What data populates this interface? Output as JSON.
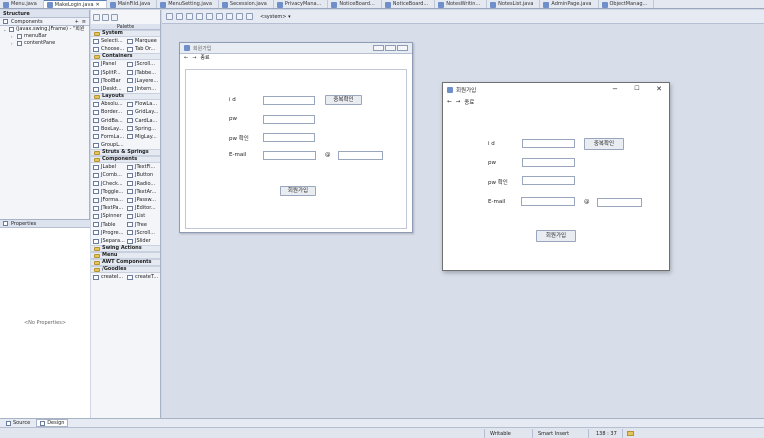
{
  "editor_tabs": [
    {
      "label": "Menu.java",
      "active": false
    },
    {
      "label": "MakeLogin.java",
      "active": true
    },
    {
      "label": "MainFild.java",
      "active": false
    },
    {
      "label": "MenuSetting.java",
      "active": false
    },
    {
      "label": "Secession.java",
      "active": false
    },
    {
      "label": "PrivacyMana...",
      "active": false
    },
    {
      "label": "NoticeBoard...",
      "active": false
    },
    {
      "label": "NoticeBoard...",
      "active": false
    },
    {
      "label": "NotesWritin...",
      "active": false
    },
    {
      "label": "NotesList.java",
      "active": false
    },
    {
      "label": "AdminPage.java",
      "active": false
    },
    {
      "label": "ObjectManag...",
      "active": false
    }
  ],
  "structure": {
    "title": "Structure",
    "components_label": "Components",
    "tree": [
      {
        "label": "(javax.swing.JFrame) - \"회원",
        "level": 0
      },
      {
        "label": "menuBar",
        "level": 1
      },
      {
        "label": "contentPane",
        "level": 1
      }
    ]
  },
  "properties": {
    "title": "Properties",
    "empty": "<No Properties>"
  },
  "palette": {
    "title": "Palette",
    "sections": [
      {
        "name": "System",
        "items": [
          "Selecti...",
          "Marquee",
          "Choose...",
          "Tab Or..."
        ]
      },
      {
        "name": "Containers",
        "items": [
          "JPanel",
          "JScroll...",
          "JSplitP...",
          "JTabbe...",
          "JToolBar",
          "JLayere...",
          "JDeskt...",
          "JIntern..."
        ]
      },
      {
        "name": "Layouts",
        "items": [
          "Absolu...",
          "FlowLa...",
          "Border...",
          "GridLay...",
          "GridBa...",
          "CardLa...",
          "BoxLay...",
          "Spring...",
          "FormLa...",
          "MigLay...",
          "GroupL..."
        ]
      },
      {
        "name": "Struts & Springs",
        "items": []
      },
      {
        "name": "Components",
        "items": [
          "JLabel",
          "JTextFi...",
          "JComb...",
          "JButton",
          "JCheck...",
          "JRadio...",
          "JToggle...",
          "JTextAr...",
          "JForma...",
          "JPassw...",
          "JTextPa...",
          "JEditor...",
          "JSpinner",
          "JList",
          "JTable",
          "JTree",
          "JProgre...",
          "JScroll...",
          "JSepara...",
          "JSlider"
        ]
      },
      {
        "name": "Swing Actions",
        "items": []
      },
      {
        "name": "Menu",
        "items": []
      },
      {
        "name": "AWT Components",
        "items": []
      },
      {
        "name": "/Goodles",
        "items": [
          "createI...",
          "createT..."
        ]
      }
    ]
  },
  "designer": {
    "lookandfeel": "<system>",
    "frame_title": "회원가입",
    "menu": {
      "back": "←",
      "forward": "→",
      "exit": "종료"
    },
    "form": {
      "id_label": "i d",
      "dup_check_button": "중복확인",
      "pw_label": "pw",
      "pw_confirm_label": "pw 확인",
      "email_label": "E-mail",
      "at_label": "@",
      "signup_button": "회원가입"
    }
  },
  "preview": {
    "title": "회원가입",
    "minimize": "−",
    "maximize": "☐",
    "close": "✕",
    "menu": {
      "back": "←",
      "forward": "→",
      "exit": "종료"
    },
    "form": {
      "id_label": "i d",
      "dup_check_button": "중복확인",
      "pw_label": "pw",
      "pw_confirm_label": "pw 확인",
      "email_label": "E-mail",
      "at_label": "@",
      "signup_button": "회원가입"
    }
  },
  "bottom_tabs": [
    {
      "label": "Source",
      "active": false
    },
    {
      "label": "Design",
      "active": true
    }
  ],
  "status": {
    "writable": "Writable",
    "insert_mode": "Smart Insert",
    "position": "138 : 37"
  }
}
